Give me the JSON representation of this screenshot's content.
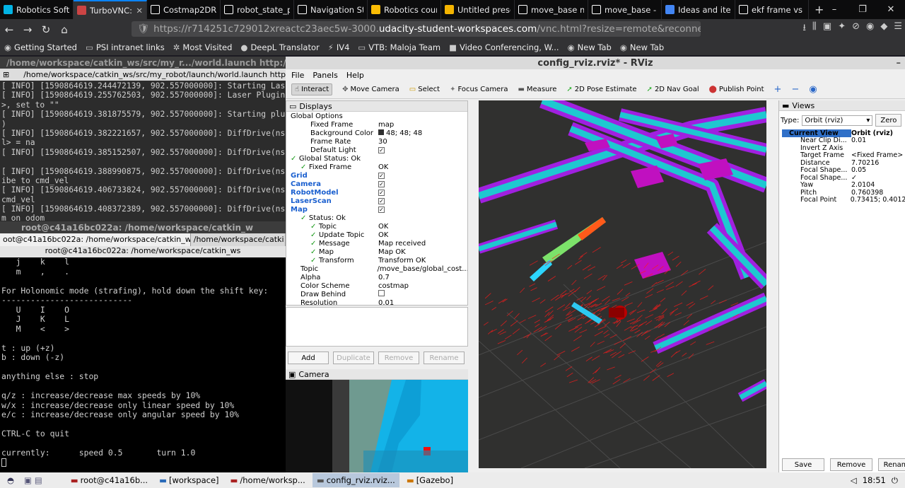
{
  "browser": {
    "tabs": [
      {
        "label": "Robotics Softw",
        "icon": "udacity-icon",
        "color": "#02b3e4"
      },
      {
        "label": "TurboVNC: ",
        "icon": "vnc-icon",
        "color": "#c44",
        "active": true
      },
      {
        "label": "Costmap2DRO",
        "icon": "grid-icon",
        "color": "#fff"
      },
      {
        "label": "robot_state_pu",
        "icon": "grid-icon",
        "color": "#fff"
      },
      {
        "label": "Navigation Sta",
        "icon": "grid-icon",
        "color": "#fff"
      },
      {
        "label": "Robotics cours",
        "icon": "drive-icon",
        "color": "#fbbc04"
      },
      {
        "label": "Untitled prese",
        "icon": "slides-icon",
        "color": "#f4b400"
      },
      {
        "label": "move_base no",
        "icon": "grid-icon",
        "color": "#fff"
      },
      {
        "label": "move_base - R",
        "icon": "grid-icon",
        "color": "#fff"
      },
      {
        "label": "Ideas and item",
        "icon": "docs-icon",
        "color": "#4285f4"
      },
      {
        "label": "ekf frame vs to",
        "icon": "grid-icon",
        "color": "#fff"
      }
    ],
    "url_prefix": "https://r714251c729012xreactc23aec5w-3000.",
    "url_domain": "udacity-student-workspaces.com",
    "url_suffix": "/vnc.html?resize=remote&reconnect=1&auto",
    "bookmarks": [
      "Getting Started",
      "PSI intranet links",
      "Most Visited",
      "DeepL Translator",
      "IV4",
      "VTB: Maloja Team",
      "Video Conferencing, W...",
      "New Tab",
      "New Tab"
    ]
  },
  "term1": {
    "title": "/home/workspace/catkin_ws/src/my_r.../world.launch http://l",
    "tab": "/home/workspace/catkin_ws/src/my_robot/launch/world.launch http",
    "lines": [
      "[ INFO] [1590864619.244472139, 902.557000000]: Starting Lase",
      "[ INFO] [1590864619.255762503, 902.557000000]: Laser Plugin",
      ">, set to \"\"",
      "[ INFO] [1590864619.381875579, 902.557000000]: Starting plug",
      ")",
      "[ INFO] [1590864619.382221657, 902.557000000]: DiffDrive(ns",
      "l> = na",
      "[ INFO] [1590864619.385152507, 902.557000000]: DiffDrive(ns",
      "",
      "[ INFO] [1590864619.388990875, 902.557000000]: DiffDrive(ns",
      "ibe to cmd_vel",
      "[ INFO] [1590864619.406733824, 902.557000000]: DiffDrive(ns",
      "cmd_vel",
      "[ INFO] [1590864619.408372389, 902.557000000]: DiffDrive(ns",
      "m on odom"
    ]
  },
  "term2": {
    "title": "root@c41a16bc022a: /home/workspace/catkin_w",
    "tab1": "oot@c41a16bc022a: /home/workspace/catkin_w:",
    "tab2": "/home/workspace/catki",
    "subtitle": "root@c41a16bc022a: /home/workspace/catkin_ws",
    "lines": [
      "   j    k    l",
      "   m    ,    .",
      "",
      "For Holonomic mode (strafing), hold down the shift key:",
      "---------------------------",
      "   U    I    O",
      "   J    K    L",
      "   M    <    >",
      "",
      "t : up (+z)",
      "b : down (-z)",
      "",
      "anything else : stop",
      "",
      "q/z : increase/decrease max speeds by 10%",
      "w/x : increase/decrease only linear speed by 10%",
      "e/c : increase/decrease only angular speed by 10%",
      "",
      "CTRL-C to quit",
      "",
      "currently:      speed 0.5       turn 1.0"
    ]
  },
  "rviz": {
    "title": "config_rviz.rviz* - RViz",
    "menu": [
      "File",
      "Panels",
      "Help"
    ],
    "tools": [
      "Interact",
      "Move Camera",
      "Select",
      "Focus Camera",
      "Measure",
      "2D Pose Estimate",
      "2D Nav Goal",
      "Publish Point"
    ],
    "displays_title": "Displays",
    "tree": [
      {
        "k": "Global Options",
        "v": "",
        "ind": 0,
        "icon": "globe"
      },
      {
        "k": "Fixed Frame",
        "v": "map",
        "ind": 2
      },
      {
        "k": "Background Color",
        "v": "48; 48; 48",
        "ind": 2,
        "swatch": true
      },
      {
        "k": "Frame Rate",
        "v": "30",
        "ind": 2
      },
      {
        "k": "Default Light",
        "v": "✓",
        "ind": 2,
        "check": true
      },
      {
        "k": "Global Status: Ok",
        "v": "",
        "ind": 0,
        "tick": true
      },
      {
        "k": "Fixed Frame",
        "v": "OK",
        "ind": 1,
        "tick": true
      },
      {
        "k": "Grid",
        "v": "✓",
        "ind": 0,
        "blue": true,
        "check": true
      },
      {
        "k": "Camera",
        "v": "✓",
        "ind": 0,
        "blue": true,
        "check": true
      },
      {
        "k": "RobotModel",
        "v": "✓",
        "ind": 0,
        "blue": true,
        "check": true
      },
      {
        "k": "LaserScan",
        "v": "✓",
        "ind": 0,
        "blue": true,
        "check": true
      },
      {
        "k": "Map",
        "v": "✓",
        "ind": 0,
        "blue": true,
        "check": true
      },
      {
        "k": "Status: Ok",
        "v": "",
        "ind": 1,
        "tick": true
      },
      {
        "k": "Topic",
        "v": "OK",
        "ind": 2,
        "tick": true
      },
      {
        "k": "Update Topic",
        "v": "OK",
        "ind": 2,
        "tick": true
      },
      {
        "k": "Message",
        "v": "Map received",
        "ind": 2,
        "tick": true
      },
      {
        "k": "Map",
        "v": "Map OK",
        "ind": 2,
        "tick": true
      },
      {
        "k": "Transform",
        "v": "Transform OK",
        "ind": 2,
        "tick": true
      },
      {
        "k": "Topic",
        "v": "/move_base/global_cost...",
        "ind": 1
      },
      {
        "k": "Alpha",
        "v": "0.7",
        "ind": 1
      },
      {
        "k": "Color Scheme",
        "v": "costmap",
        "ind": 1
      },
      {
        "k": "Draw Behind",
        "v": "",
        "ind": 1,
        "check": true
      },
      {
        "k": "Resolution",
        "v": "0.01",
        "ind": 1
      }
    ],
    "buttons": {
      "add": "Add",
      "duplicate": "Duplicate",
      "remove": "Remove",
      "rename": "Rename"
    },
    "camera_title": "Camera",
    "views_title": "Views",
    "type_label": "Type:",
    "type_value": "Orbit (rviz)",
    "zero_label": "Zero",
    "views_tree": [
      {
        "k": "Current View",
        "v": "Orbit (rviz)",
        "bold": true
      },
      {
        "k": "Near Clip Di...",
        "v": "0.01"
      },
      {
        "k": "Invert Z Axis",
        "v": ""
      },
      {
        "k": "Target Frame",
        "v": "<Fixed Frame>"
      },
      {
        "k": "Distance",
        "v": "7.70216"
      },
      {
        "k": "Focal Shape...",
        "v": "0.05"
      },
      {
        "k": "Focal Shape...",
        "v": "✓"
      },
      {
        "k": "Yaw",
        "v": "2.0104"
      },
      {
        "k": "Pitch",
        "v": "0.760398"
      },
      {
        "k": "Focal Point",
        "v": "0.73415; 0.4012"
      }
    ],
    "views_buttons": {
      "save": "Save",
      "remove": "Remove",
      "rename": "Renam"
    }
  },
  "taskbar": {
    "items": [
      "root@c41a16b...",
      "[workspace]",
      "/home/worksp...",
      "config_rviz.rviz...",
      "[Gazebo]"
    ],
    "clock": "18:51"
  }
}
